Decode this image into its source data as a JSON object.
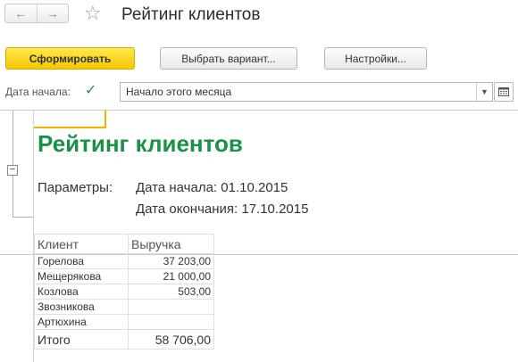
{
  "window": {
    "title": "Рейтинг клиентов",
    "back_icon": "arrow-left-icon",
    "forward_icon": "arrow-right-icon",
    "favorite_icon": "star-icon"
  },
  "toolbar": {
    "generate_label": "Сформировать",
    "variant_label": "Выбрать вариант...",
    "settings_label": "Настройки..."
  },
  "params": {
    "start_date_label": "Дата начала:",
    "start_date_checked": true,
    "start_date_value": "Начало этого месяца"
  },
  "report": {
    "title": "Рейтинг клиентов",
    "params_label": "Параметры:",
    "param_start": "Дата начала: 01.10.2015",
    "param_end": "Дата окончания: 17.10.2015",
    "columns": [
      "Клиент",
      "Выручка"
    ],
    "rows": [
      {
        "client": "Горелова",
        "revenue": "37 203,00"
      },
      {
        "client": "Мещерякова",
        "revenue": "21 000,00"
      },
      {
        "client": "Козлова",
        "revenue": "503,00"
      },
      {
        "client": "Звозникова",
        "revenue": ""
      },
      {
        "client": "Артюхина",
        "revenue": ""
      }
    ],
    "total_label": "Итого",
    "total_value": "58 706,00"
  },
  "colors": {
    "accent_button": "#f4c700",
    "report_title": "#1a9146",
    "checkbox": "#1d9c3a"
  }
}
